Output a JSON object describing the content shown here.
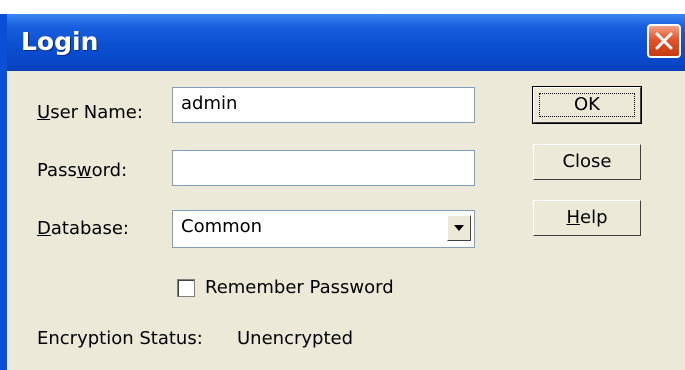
{
  "window": {
    "title": "Login"
  },
  "fields": {
    "username_label_pre": "",
    "username_label_u": "U",
    "username_label_post": "ser Name:",
    "username_value": "admin",
    "password_label_pre": "Pass",
    "password_label_u": "w",
    "password_label_post": "ord:",
    "password_value": "",
    "database_label_pre": "",
    "database_label_u": "D",
    "database_label_post": "atabase:",
    "database_value": "Common"
  },
  "options": {
    "remember_password_label": "Remember Password",
    "remember_password_checked": false
  },
  "status": {
    "label": "Encryption Status:",
    "value": "Unencrypted"
  },
  "buttons": {
    "ok": "OK",
    "close": "Close",
    "help_pre": "",
    "help_u": "H",
    "help_post": "elp"
  },
  "icons": {
    "close": "close-icon",
    "dropdown": "chevron-down-icon"
  },
  "colors": {
    "titlebar": "#0b4fd1",
    "close_button": "#e3542b",
    "dialog_face": "#ece9d8"
  }
}
